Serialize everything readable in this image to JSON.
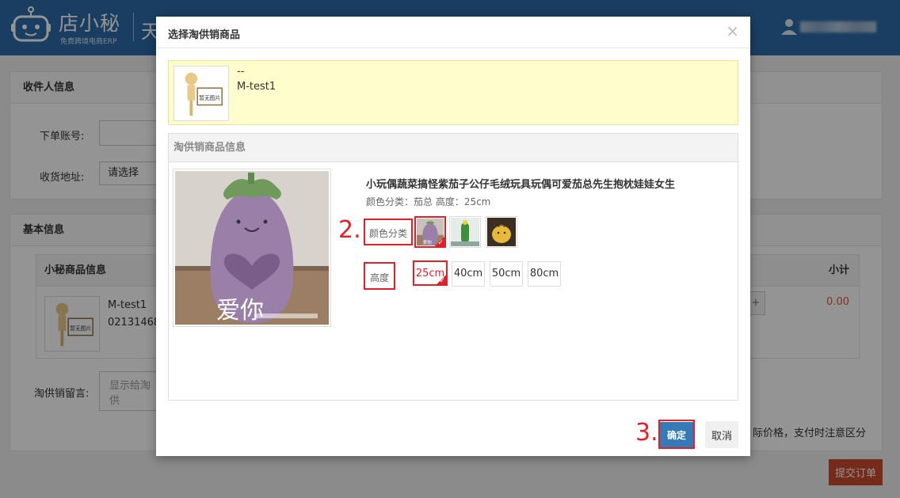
{
  "app": {
    "logo_name": "店小秘",
    "logo_sub": "免费跨境电商ERP",
    "page_title_fragment": "天"
  },
  "background": {
    "receiver_section_title": "收件人信息",
    "order_account_label": "下单账号:",
    "shipping_address_label": "收货地址:",
    "shipping_address_select": "请选择",
    "basic_info_title": "基本信息",
    "product_info_header": "小秘商品信息",
    "subtotal_header": "小计",
    "product_name": "M-test1",
    "product_code": "02131468",
    "subtotal_value": "0.00",
    "message_label": "淘供销留言:",
    "message_placeholder": "显示给淘供",
    "price_note": "际价格，支付时注意区分",
    "submit_button": "提交订单",
    "placeholder_text": "暂无图片"
  },
  "modal": {
    "title": "选择淘供销商品",
    "close_glyph": "×",
    "product_card": {
      "dash": "--",
      "name": "M-test1",
      "placeholder_text": "暂无图片"
    },
    "section_title": "淘供销商品信息",
    "main_image_caption": "爱你",
    "item_title": "小玩偶蔬菜搞怪紫茄子公仔毛绒玩具玩偶可爱茄总先生抱枕娃娃女生",
    "selected_summary": "颜色分类：茄总 高度：25cm",
    "color_label": "颜色分类",
    "height_label": "高度",
    "swatch_caption": "爱你",
    "height_options": [
      "25cm",
      "40cm",
      "50cm",
      "80cm"
    ],
    "annotations": {
      "step2": "2.",
      "step3": "3."
    },
    "confirm_button": "确定",
    "cancel_button": "取消",
    "check_glyph": "✓"
  },
  "colors": {
    "topbar": "#2e6ca8",
    "annotation_red": "#e0202a",
    "confirm_blue": "#337ab7",
    "submit_orange": "#c84b2c",
    "card_yellow": "#fffdcc"
  }
}
